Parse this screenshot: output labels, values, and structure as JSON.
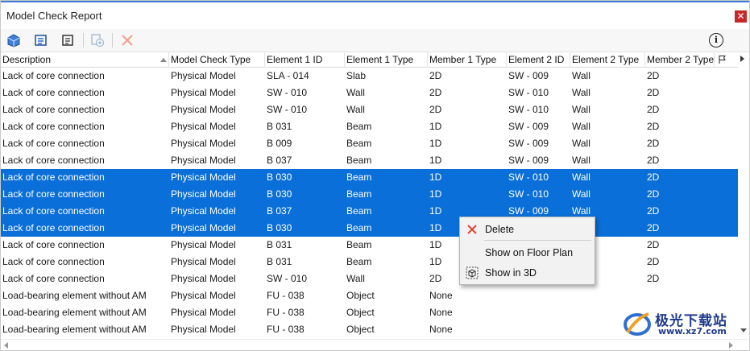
{
  "window": {
    "title": "Model Check Report",
    "close_glyph": "✕"
  },
  "toolbar": {
    "icons": [
      "model-check-icon",
      "element-props-icon",
      "element-props-alt-icon",
      "add-to-selection-icon",
      "delete-icon"
    ],
    "info_glyph": "i"
  },
  "columns": [
    "Description",
    "Model Check Type",
    "Element 1 ID",
    "Element 1 Type",
    "Member 1 Type",
    "Element 2 ID",
    "Element 2 Type",
    "Member 2 Type"
  ],
  "rows": [
    {
      "desc": "Lack of core connection",
      "check": "Physical Model",
      "e1id": "SLA - 014",
      "e1type": "Slab",
      "m1": "2D",
      "e2id": "SW - 009",
      "e2type": "Wall",
      "m2": "2D",
      "selected": false
    },
    {
      "desc": "Lack of core connection",
      "check": "Physical Model",
      "e1id": "SW - 010",
      "e1type": "Wall",
      "m1": "2D",
      "e2id": "SW - 010",
      "e2type": "Wall",
      "m2": "2D",
      "selected": false
    },
    {
      "desc": "Lack of core connection",
      "check": "Physical Model",
      "e1id": "SW - 010",
      "e1type": "Wall",
      "m1": "2D",
      "e2id": "SW - 010",
      "e2type": "Wall",
      "m2": "2D",
      "selected": false
    },
    {
      "desc": "Lack of core connection",
      "check": "Physical Model",
      "e1id": "B 031",
      "e1type": "Beam",
      "m1": "1D",
      "e2id": "SW - 009",
      "e2type": "Wall",
      "m2": "2D",
      "selected": false
    },
    {
      "desc": "Lack of core connection",
      "check": "Physical Model",
      "e1id": "B 009",
      "e1type": "Beam",
      "m1": "1D",
      "e2id": "SW - 009",
      "e2type": "Wall",
      "m2": "2D",
      "selected": false
    },
    {
      "desc": "Lack of core connection",
      "check": "Physical Model",
      "e1id": "B 037",
      "e1type": "Beam",
      "m1": "1D",
      "e2id": "SW - 009",
      "e2type": "Wall",
      "m2": "2D",
      "selected": false
    },
    {
      "desc": "Lack of core connection",
      "check": "Physical Model",
      "e1id": "B 030",
      "e1type": "Beam",
      "m1": "1D",
      "e2id": "SW - 010",
      "e2type": "Wall",
      "m2": "2D",
      "selected": true
    },
    {
      "desc": "Lack of core connection",
      "check": "Physical Model",
      "e1id": "B 030",
      "e1type": "Beam",
      "m1": "1D",
      "e2id": "SW - 010",
      "e2type": "Wall",
      "m2": "2D",
      "selected": true
    },
    {
      "desc": "Lack of core connection",
      "check": "Physical Model",
      "e1id": "B 037",
      "e1type": "Beam",
      "m1": "1D",
      "e2id": "SW - 009",
      "e2type": "Wall",
      "m2": "2D",
      "selected": true
    },
    {
      "desc": "Lack of core connection",
      "check": "Physical Model",
      "e1id": "B 030",
      "e1type": "Beam",
      "m1": "1D",
      "e2id": "",
      "e2type": "",
      "m2": "2D",
      "selected": true
    },
    {
      "desc": "Lack of core connection",
      "check": "Physical Model",
      "e1id": "B 031",
      "e1type": "Beam",
      "m1": "1D",
      "e2id": "",
      "e2type": "",
      "m2": "2D",
      "selected": false
    },
    {
      "desc": "Lack of core connection",
      "check": "Physical Model",
      "e1id": "B 031",
      "e1type": "Beam",
      "m1": "1D",
      "e2id": "",
      "e2type": "",
      "m2": "2D",
      "selected": false
    },
    {
      "desc": "Lack of core connection",
      "check": "Physical Model",
      "e1id": "SW - 010",
      "e1type": "Wall",
      "m1": "2D",
      "e2id": "",
      "e2type": "",
      "m2": "2D",
      "selected": false
    },
    {
      "desc": "Load-bearing element without AM",
      "check": "Physical Model",
      "e1id": "FU - 038",
      "e1type": "Object",
      "m1": "None",
      "e2id": "",
      "e2type": "",
      "m2": "",
      "selected": false
    },
    {
      "desc": "Load-bearing element without AM",
      "check": "Physical Model",
      "e1id": "FU - 038",
      "e1type": "Object",
      "m1": "None",
      "e2id": "",
      "e2type": "",
      "m2": "",
      "selected": false
    },
    {
      "desc": "Load-bearing element without AM",
      "check": "Physical Model",
      "e1id": "FU - 038",
      "e1type": "Object",
      "m1": "None",
      "e2id": "",
      "e2type": "",
      "m2": "",
      "selected": false
    }
  ],
  "context_menu": {
    "items": [
      {
        "label": "Delete",
        "icon": "delete-x-icon"
      },
      {
        "label": "Show on Floor Plan",
        "icon": ""
      },
      {
        "label": "Show in 3D",
        "icon": "show-3d-icon"
      }
    ]
  },
  "watermark": {
    "brand": "极光下载站",
    "url": "www.xz7.com"
  },
  "colors": {
    "selection": "#0a6fd8",
    "accent_blue": "#2f6fd0",
    "close_red": "#c62828",
    "delete_red": "#e0452f"
  }
}
